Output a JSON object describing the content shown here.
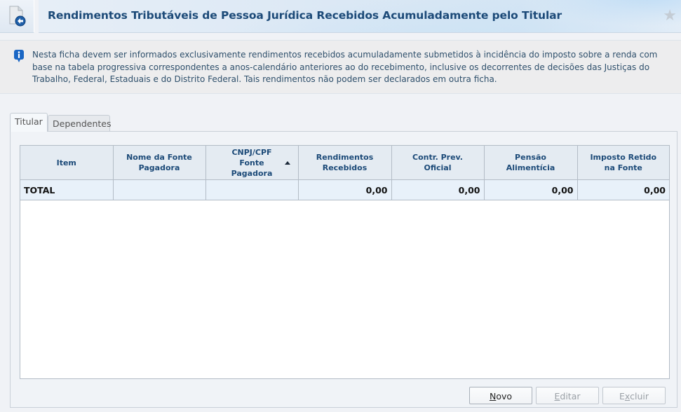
{
  "header": {
    "title": "Rendimentos Tributáveis de Pessoa Jurídica Recebidos Acumuladamente pelo Titular",
    "icon": "document-back-icon",
    "favorite_icon": "star-icon"
  },
  "info": {
    "icon": "info-icon",
    "text": "Nesta ficha devem ser informados exclusivamente rendimentos recebidos acumuladamente submetidos à incidência do imposto sobre a renda com base na tabela progressiva correspondentes a anos-calendário anteriores ao do recebimento, inclusive os decorrentes de decisões das Justiças do Trabalho, Federal, Estaduais e do Distrito Federal. Tais rendimentos não podem ser declarados em outra ficha."
  },
  "tabs": [
    {
      "label": "Titular",
      "active": true
    },
    {
      "label": "Dependentes",
      "active": false
    }
  ],
  "table": {
    "columns": [
      {
        "line1": "Item",
        "line2": ""
      },
      {
        "line1": "Nome da Fonte",
        "line2": "Pagadora"
      },
      {
        "line1": "CNPJ/CPF",
        "line2": "Fonte",
        "line3": "Pagadora",
        "sorted": "ascending"
      },
      {
        "line1": "Rendimentos",
        "line2": "Recebidos"
      },
      {
        "line1": "Contr. Prev.",
        "line2": "Oficial"
      },
      {
        "line1": "Pensão",
        "line2": "Alimentícia"
      },
      {
        "line1": "Imposto Retido",
        "line2": "na Fonte"
      }
    ],
    "total_row": {
      "label": "TOTAL",
      "nome": "",
      "cnpj": "",
      "rendimentos": "0,00",
      "contr_prev": "0,00",
      "pensao": "0,00",
      "imposto": "0,00"
    }
  },
  "buttons": {
    "novo": {
      "mnemonic": "N",
      "rest": "ovo",
      "enabled": true
    },
    "editar": {
      "mnemonic": "E",
      "rest": "ditar",
      "enabled": false
    },
    "excluir": {
      "pre": "E",
      "mnemonic": "x",
      "rest": "cluir",
      "enabled": false
    }
  }
}
